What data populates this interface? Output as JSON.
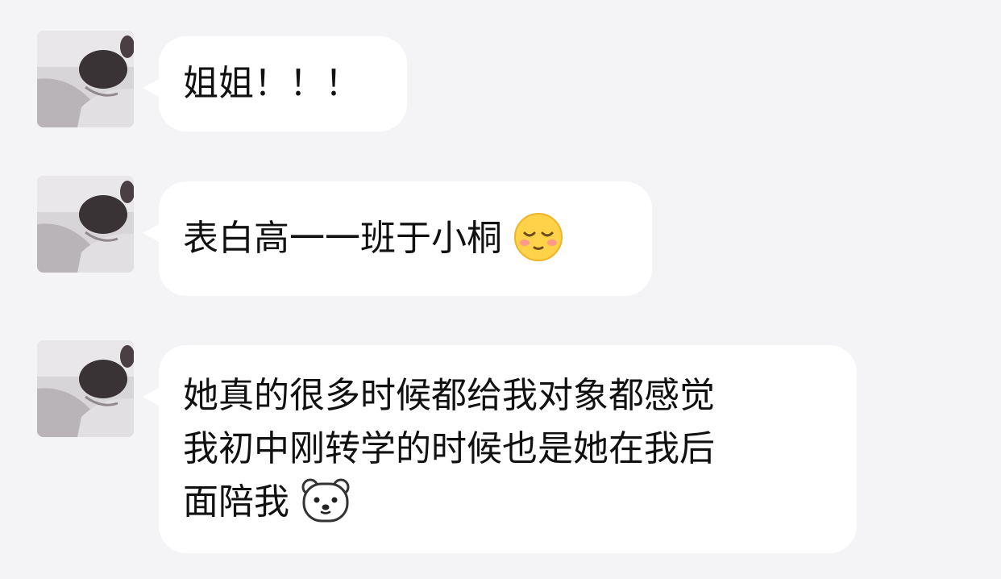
{
  "chat": {
    "messages": [
      {
        "sender_avatar": "profile-photo",
        "text": "姐姐！！！"
      },
      {
        "sender_avatar": "profile-photo",
        "text": "表白高一一班于小桐",
        "emoji": "shy-blush-face-emoji"
      },
      {
        "sender_avatar": "profile-photo",
        "lines": [
          "她真的很多时候都给我对象都感觉",
          "我初中刚转学的时候也是她在我后",
          "面陪我"
        ],
        "emoji": "polar-bear-emoji"
      }
    ]
  },
  "colors": {
    "background": "#f4f4f6",
    "bubble": "#ffffff",
    "text": "#111111"
  }
}
